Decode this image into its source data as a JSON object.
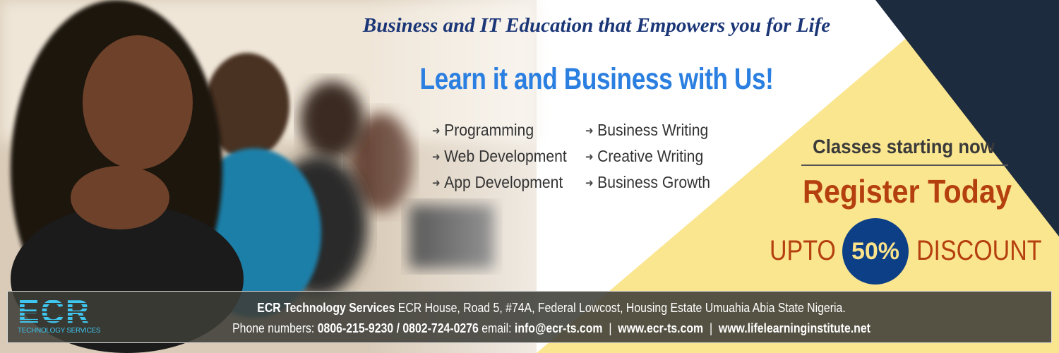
{
  "tagline": "Business and IT Education that Empowers you for Life",
  "headline": "Learn it and Business with Us!",
  "courses": {
    "left": [
      "Programming",
      "Web Development",
      "App Development"
    ],
    "right": [
      "Business Writing",
      "Creative Writing",
      "Business Growth"
    ],
    "bullet_icon": "arrow-right-icon"
  },
  "promo": {
    "classes": "Classes starting now",
    "register": "Register Today",
    "upto": "UPTO",
    "discount_value": "50%",
    "discount": "DISCOUNT"
  },
  "footer": {
    "logo_text": "ECR",
    "logo_sub": "TECHNOLOGY SERVICES",
    "company": "ECR Technology Services",
    "address": "ECR House, Road 5, #74A, Federal Lowcost, Housing Estate Umuahia Abia State Nigeria.",
    "phone_label": "Phone numbers:",
    "phones": "0806-215-9230 / 0802-724-0276",
    "email_label": "email:",
    "email": "info@ecr-ts.com",
    "sep": "|",
    "website1": "www.ecr-ts.com",
    "website2": "www.lifelearninginstitute.net"
  },
  "colors": {
    "navy": "#1c2b3e",
    "yellow": "#fbe690",
    "blue": "#2b7fe0",
    "orange": "#b5400f",
    "circle": "#0d3f86"
  }
}
